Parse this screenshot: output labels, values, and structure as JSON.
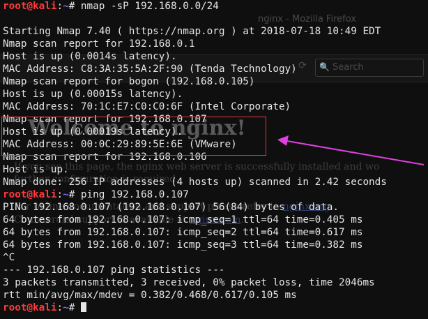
{
  "background_page": {
    "window_title": "nginx - Mozilla Firefox",
    "search_placeholder": "Search",
    "heading": "Welcome to nginx!",
    "paragraphs": [
      "If you see this page, the nginx web server is successfully installed and wo",
      "further configuration is required.",
      "For online documentation and support please refer to",
      "Commercial support is available at"
    ],
    "link_docs": "nginx.org",
    "link_commercial": "nginx.com"
  },
  "terminal": {
    "prompt": {
      "user_host": "root@kali",
      "separator": ":",
      "path": "~",
      "symbol": "# "
    },
    "commands": {
      "nmap": "nmap -sP 192.168.0.0/24",
      "ping": "ping 192.168.0.107"
    },
    "nmap_output": [
      "",
      "Starting Nmap 7.40 ( https://nmap.org ) at 2018-07-18 10:49 EDT",
      "Nmap scan report for 192.168.0.1",
      "Host is up (0.0014s latency).",
      "MAC Address: C8:3A:35:5A:2F:90 (Tenda Technology)",
      "Nmap scan report for bogon (192.168.0.105)",
      "Host is up (0.00015s latency).",
      "MAC Address: 70:1C:E7:C0:C0:6F (Intel Corporate)",
      "Nmap scan report for 192.168.0.107",
      "Host is up (0.00019s latency).",
      "MAC Address: 00:0C:29:89:5E:6E (VMware)",
      "Nmap scan report for 192.168.0.106",
      "Host is up.",
      "Nmap done: 256 IP addresses (4 hosts up) scanned in 2.42 seconds"
    ],
    "ping_output": [
      "PING 192.168.0.107 (192.168.0.107) 56(84) bytes of data.",
      "64 bytes from 192.168.0.107: icmp_seq=1 ttl=64 time=0.405 ms",
      "64 bytes from 192.168.0.107: icmp_seq=2 ttl=64 time=0.617 ms",
      "64 bytes from 192.168.0.107: icmp_seq=3 ttl=64 time=0.382 ms",
      "^C",
      "--- 192.168.0.107 ping statistics ---",
      "3 packets transmitted, 3 received, 0% packet loss, time 2046ms",
      "rtt min/avg/max/mdev = 0.382/0.468/0.617/0.105 ms"
    ]
  },
  "annotation": {
    "box_color": "#e23c3c",
    "arrow_color": "#e040e0"
  },
  "colors": {
    "background": "#0f0f0f",
    "text": "#e5e5e5",
    "prompt_user": "#ff3a3a",
    "prompt_path": "#6f6fff"
  }
}
